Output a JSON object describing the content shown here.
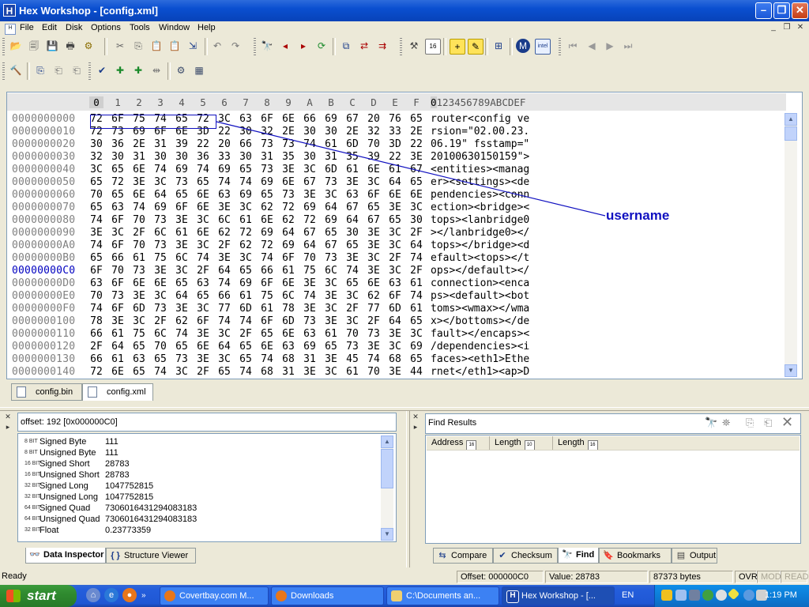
{
  "window": {
    "title": "Hex Workshop - [config.xml]"
  },
  "menu": [
    "File",
    "Edit",
    "Disk",
    "Options",
    "Tools",
    "Window",
    "Help"
  ],
  "hex": {
    "columns": [
      "0",
      "1",
      "2",
      "3",
      "4",
      "5",
      "6",
      "7",
      "8",
      "9",
      "A",
      "B",
      "C",
      "D",
      "E",
      "F"
    ],
    "ascii_header": "0123456789ABCDEF",
    "rows": [
      {
        "offset": "0000000000",
        "bytes": [
          "72",
          "6F",
          "75",
          "74",
          "65",
          "72",
          "3C",
          "63",
          "6F",
          "6E",
          "66",
          "69",
          "67",
          "20",
          "76",
          "65"
        ],
        "ascii": "router<config ve"
      },
      {
        "offset": "0000000010",
        "bytes": [
          "72",
          "73",
          "69",
          "6F",
          "6E",
          "3D",
          "22",
          "30",
          "32",
          "2E",
          "30",
          "30",
          "2E",
          "32",
          "33",
          "2E"
        ],
        "ascii": "rsion=\"02.00.23."
      },
      {
        "offset": "0000000020",
        "bytes": [
          "30",
          "36",
          "2E",
          "31",
          "39",
          "22",
          "20",
          "66",
          "73",
          "73",
          "74",
          "61",
          "6D",
          "70",
          "3D",
          "22"
        ],
        "ascii": "06.19\" fsstamp=\""
      },
      {
        "offset": "0000000030",
        "bytes": [
          "32",
          "30",
          "31",
          "30",
          "30",
          "36",
          "33",
          "30",
          "31",
          "35",
          "30",
          "31",
          "35",
          "39",
          "22",
          "3E"
        ],
        "ascii": "20100630150159\">"
      },
      {
        "offset": "0000000040",
        "bytes": [
          "3C",
          "65",
          "6E",
          "74",
          "69",
          "74",
          "69",
          "65",
          "73",
          "3E",
          "3C",
          "6D",
          "61",
          "6E",
          "61",
          "67"
        ],
        "ascii": "<entities><manag"
      },
      {
        "offset": "0000000050",
        "bytes": [
          "65",
          "72",
          "3E",
          "3C",
          "73",
          "65",
          "74",
          "74",
          "69",
          "6E",
          "67",
          "73",
          "3E",
          "3C",
          "64",
          "65"
        ],
        "ascii": "er><settings><de"
      },
      {
        "offset": "0000000060",
        "bytes": [
          "70",
          "65",
          "6E",
          "64",
          "65",
          "6E",
          "63",
          "69",
          "65",
          "73",
          "3E",
          "3C",
          "63",
          "6F",
          "6E",
          "6E"
        ],
        "ascii": "pendencies><conn"
      },
      {
        "offset": "0000000070",
        "bytes": [
          "65",
          "63",
          "74",
          "69",
          "6F",
          "6E",
          "3E",
          "3C",
          "62",
          "72",
          "69",
          "64",
          "67",
          "65",
          "3E",
          "3C"
        ],
        "ascii": "ection><bridge><"
      },
      {
        "offset": "0000000080",
        "bytes": [
          "74",
          "6F",
          "70",
          "73",
          "3E",
          "3C",
          "6C",
          "61",
          "6E",
          "62",
          "72",
          "69",
          "64",
          "67",
          "65",
          "30"
        ],
        "ascii": "tops><lanbridge0"
      },
      {
        "offset": "0000000090",
        "bytes": [
          "3E",
          "3C",
          "2F",
          "6C",
          "61",
          "6E",
          "62",
          "72",
          "69",
          "64",
          "67",
          "65",
          "30",
          "3E",
          "3C",
          "2F"
        ],
        "ascii": "></lanbridge0></"
      },
      {
        "offset": "00000000A0",
        "bytes": [
          "74",
          "6F",
          "70",
          "73",
          "3E",
          "3C",
          "2F",
          "62",
          "72",
          "69",
          "64",
          "67",
          "65",
          "3E",
          "3C",
          "64"
        ],
        "ascii": "tops></bridge><d"
      },
      {
        "offset": "00000000B0",
        "bytes": [
          "65",
          "66",
          "61",
          "75",
          "6C",
          "74",
          "3E",
          "3C",
          "74",
          "6F",
          "70",
          "73",
          "3E",
          "3C",
          "2F",
          "74"
        ],
        "ascii": "efault><tops></t"
      },
      {
        "offset": "00000000C0",
        "bytes": [
          "6F",
          "70",
          "73",
          "3E",
          "3C",
          "2F",
          "64",
          "65",
          "66",
          "61",
          "75",
          "6C",
          "74",
          "3E",
          "3C",
          "2F"
        ],
        "ascii": "ops></default></"
      },
      {
        "offset": "00000000D0",
        "bytes": [
          "63",
          "6F",
          "6E",
          "6E",
          "65",
          "63",
          "74",
          "69",
          "6F",
          "6E",
          "3E",
          "3C",
          "65",
          "6E",
          "63",
          "61"
        ],
        "ascii": "connection><enca"
      },
      {
        "offset": "00000000E0",
        "bytes": [
          "70",
          "73",
          "3E",
          "3C",
          "64",
          "65",
          "66",
          "61",
          "75",
          "6C",
          "74",
          "3E",
          "3C",
          "62",
          "6F",
          "74"
        ],
        "ascii": "ps><default><bot"
      },
      {
        "offset": "00000000F0",
        "bytes": [
          "74",
          "6F",
          "6D",
          "73",
          "3E",
          "3C",
          "77",
          "6D",
          "61",
          "78",
          "3E",
          "3C",
          "2F",
          "77",
          "6D",
          "61"
        ],
        "ascii": "toms><wmax></wma"
      },
      {
        "offset": "0000000100",
        "bytes": [
          "78",
          "3E",
          "3C",
          "2F",
          "62",
          "6F",
          "74",
          "74",
          "6F",
          "6D",
          "73",
          "3E",
          "3C",
          "2F",
          "64",
          "65"
        ],
        "ascii": "x></bottoms></de"
      },
      {
        "offset": "0000000110",
        "bytes": [
          "66",
          "61",
          "75",
          "6C",
          "74",
          "3E",
          "3C",
          "2F",
          "65",
          "6E",
          "63",
          "61",
          "70",
          "73",
          "3E",
          "3C"
        ],
        "ascii": "fault></encaps><"
      },
      {
        "offset": "0000000120",
        "bytes": [
          "2F",
          "64",
          "65",
          "70",
          "65",
          "6E",
          "64",
          "65",
          "6E",
          "63",
          "69",
          "65",
          "73",
          "3E",
          "3C",
          "69"
        ],
        "ascii": "/dependencies><i"
      },
      {
        "offset": "0000000130",
        "bytes": [
          "66",
          "61",
          "63",
          "65",
          "73",
          "3E",
          "3C",
          "65",
          "74",
          "68",
          "31",
          "3E",
          "45",
          "74",
          "68",
          "65"
        ],
        "ascii": "faces><eth1>Ethe"
      },
      {
        "offset": "0000000140",
        "bytes": [
          "72",
          "6E",
          "65",
          "74",
          "3C",
          "2F",
          "65",
          "74",
          "68",
          "31",
          "3E",
          "3C",
          "61",
          "70",
          "3E",
          "44"
        ],
        "ascii": "rnet</eth1><ap>D"
      }
    ]
  },
  "annotation": {
    "label": "username",
    "color": "#1010c0"
  },
  "doc_tabs": [
    "config.bin",
    "config.xml"
  ],
  "inspector": {
    "offset_text": "offset: 192 [0x000000C0]",
    "rows": [
      {
        "bits": "8 BIT",
        "label": "Signed Byte",
        "value": "111"
      },
      {
        "bits": "8 BIT",
        "label": "Unsigned Byte",
        "value": "111"
      },
      {
        "bits": "16 BIT",
        "label": "Signed Short",
        "value": "28783"
      },
      {
        "bits": "16 BIT",
        "label": "Unsigned Short",
        "value": "28783"
      },
      {
        "bits": "32 BIT",
        "label": "Signed Long",
        "value": "1047752815"
      },
      {
        "bits": "32 BIT",
        "label": "Unsigned Long",
        "value": "1047752815"
      },
      {
        "bits": "64 BIT",
        "label": "Signed Quad",
        "value": "7306016431294083183"
      },
      {
        "bits": "64 BIT",
        "label": "Unsigned Quad",
        "value": "7306016431294083183"
      },
      {
        "bits": "32 BIT",
        "label": "Float",
        "value": "0.23773359"
      }
    ],
    "tabs": [
      "Data Inspector",
      "Structure Viewer"
    ]
  },
  "find": {
    "title": "Find Results",
    "columns": [
      "Address",
      "Length",
      "Length"
    ],
    "tabs": [
      "Compare",
      "Checksum",
      "Find",
      "Bookmarks",
      "Output"
    ]
  },
  "status": {
    "ready": "Ready",
    "offset": "Offset: 000000C0",
    "value": "Value: 28783",
    "size": "87373 bytes",
    "ovr": "OVR",
    "mod": "MOD",
    "read": "READ"
  },
  "taskbar": {
    "start": "start",
    "tasks": [
      "Covertbay.com M...",
      "Downloads",
      "C:\\Documents an...",
      "Hex Workshop - [..."
    ],
    "lang": "EN",
    "clock": "1:19 PM"
  }
}
